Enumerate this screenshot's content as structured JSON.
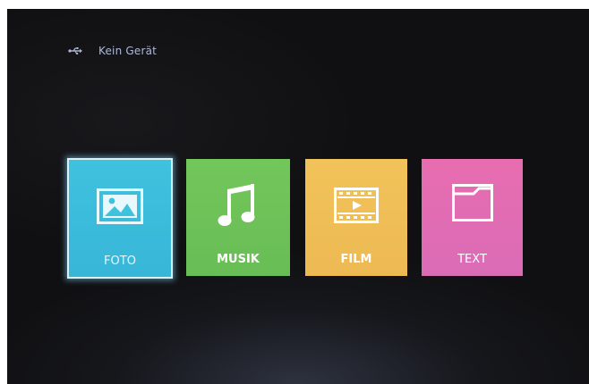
{
  "status": {
    "icon": "usb-icon",
    "label": "Kein Gerät"
  },
  "menu": {
    "selected_index": 0,
    "tiles": [
      {
        "label": "FOTO",
        "icon": "photo-icon",
        "color": "#3fc2de"
      },
      {
        "label": "MUSIK",
        "icon": "music-note-icon",
        "color": "#72c65a"
      },
      {
        "label": "FILM",
        "icon": "film-icon",
        "color": "#f2c35a"
      },
      {
        "label": "TEXT",
        "icon": "folder-icon",
        "color": "#e86db0"
      }
    ]
  }
}
